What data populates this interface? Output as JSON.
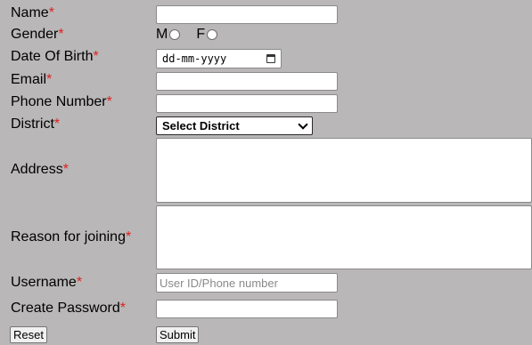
{
  "form": {
    "name_label": "Name",
    "gender_label": "Gender",
    "gender_options": [
      "M",
      "F"
    ],
    "dob_label": "Date Of Birth",
    "dob_placeholder": "dd-mm-yyyy",
    "email_label": "Email",
    "phone_label": "Phone Number",
    "district_label": "District",
    "district_selected": "Select District",
    "address_label": "Address",
    "reason_label": "Reason for joining",
    "username_label": "Username",
    "username_placeholder": "User ID/Phone number",
    "password_label": "Create Password",
    "required_mark": "*"
  },
  "buttons": {
    "reset": "Reset",
    "submit": "Submit"
  },
  "icons": {
    "calendar": "calendar-icon",
    "dropdown": "chevron-down-icon"
  },
  "colors": {
    "background": "#b9b7b7",
    "required": "#e02020"
  }
}
